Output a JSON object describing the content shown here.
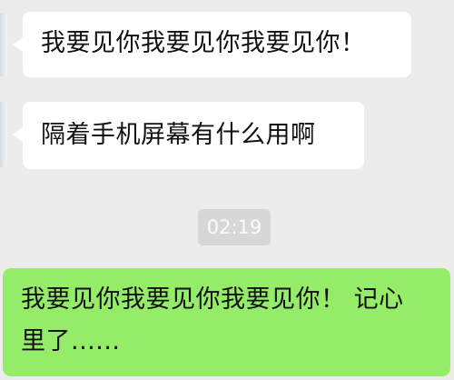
{
  "messages": [
    {
      "direction": "incoming",
      "text": "我要见你我要见你我要见你！"
    },
    {
      "direction": "incoming",
      "text": "隔着手机屏幕有什么用啊"
    },
    {
      "direction": "outgoing",
      "line1": "我要见你我要见你我要见你！ 记心",
      "line2": "里了......"
    }
  ],
  "timestamp": "02:19",
  "colors": {
    "background": "#ececec",
    "incoming_bubble": "#ffffff",
    "outgoing_bubble": "#95ec69",
    "timestamp_badge": "#d7d7d7"
  }
}
